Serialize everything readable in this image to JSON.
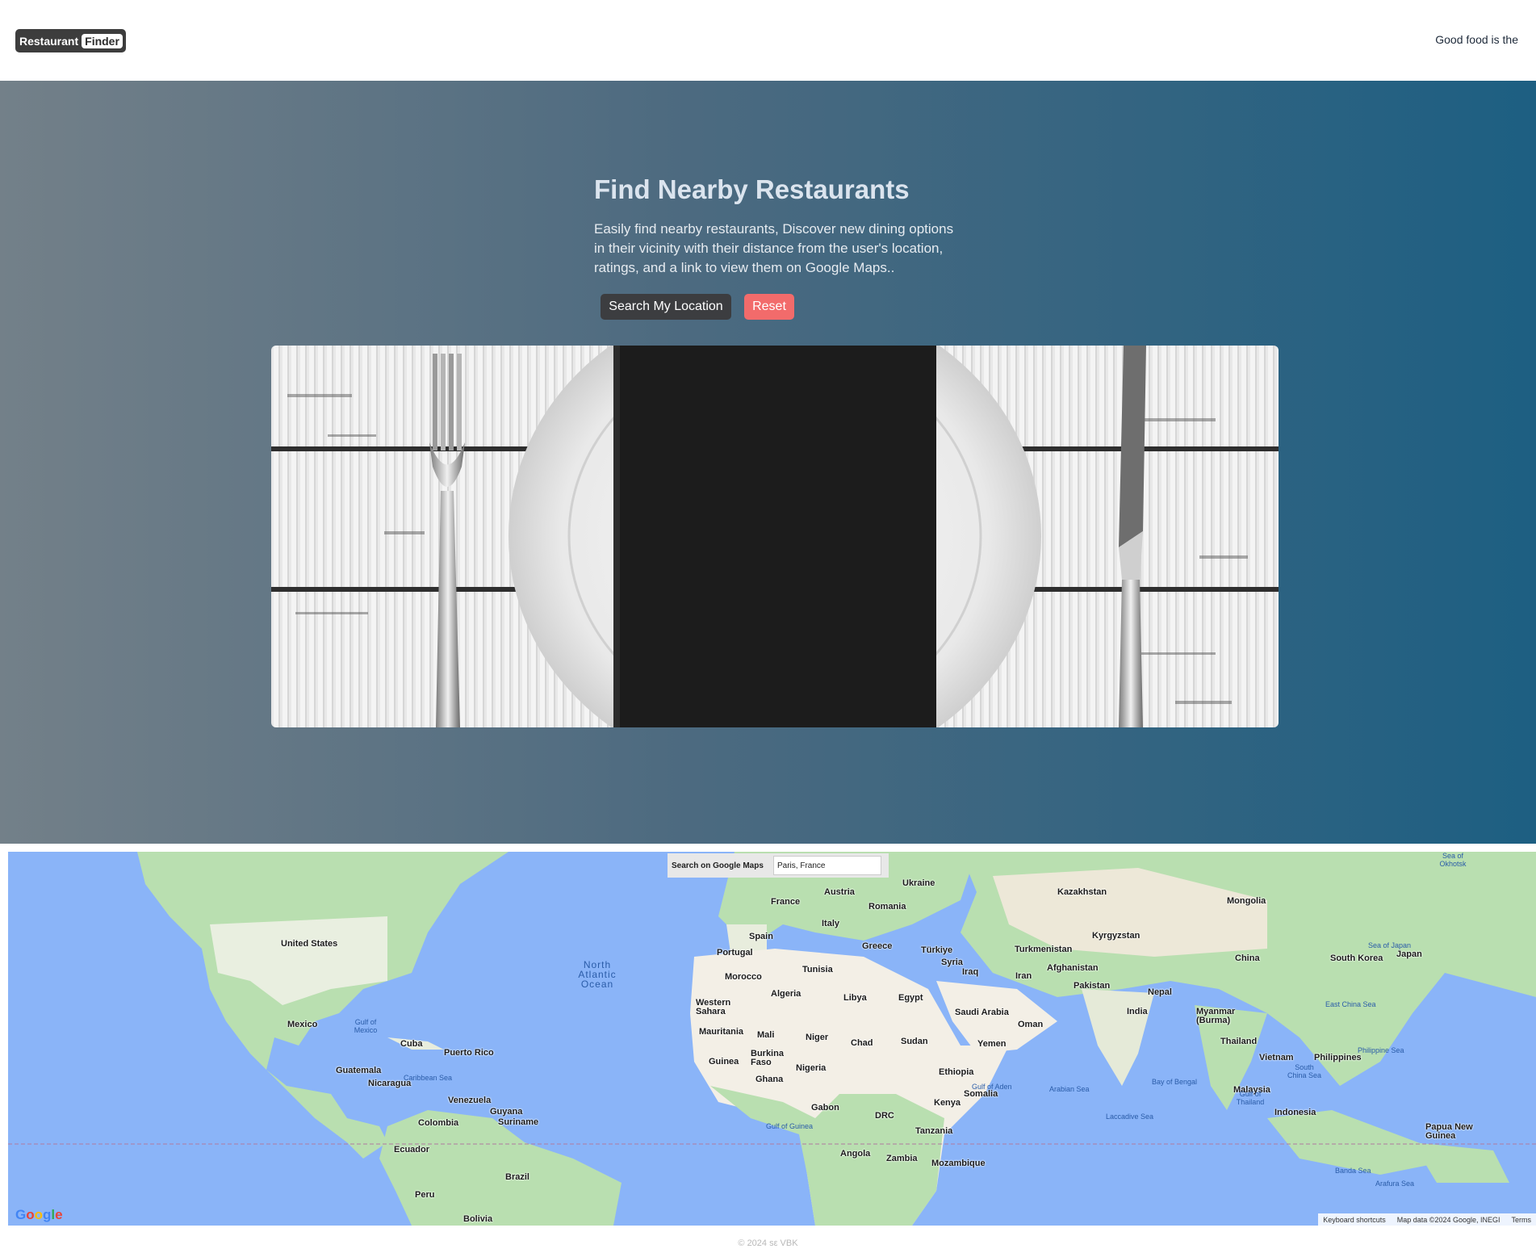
{
  "navbar": {
    "brand_part1": "Restaurant",
    "brand_part2": "Finder",
    "tagline": "Good food is the"
  },
  "hero": {
    "title": "Find Nearby Restaurants",
    "description": "Easily find nearby restaurants, Discover new dining options in their vicinity with their distance from the user's location, ratings, and a link to view them on Google Maps..",
    "search_button": "Search My Location",
    "reset_button": "Reset"
  },
  "map": {
    "search_label": "Search on Google Maps",
    "search_value": "Paris, France",
    "logo": "Google",
    "footer": [
      "Keyboard shortcuts",
      "Map data ©2024 Google, INEGI",
      "Terms"
    ],
    "countries": [
      "United States",
      "Mexico",
      "Cuba",
      "Puerto Rico",
      "Guatemala",
      "Nicaragua",
      "Venezuela",
      "Guyana",
      "Suriname",
      "Colombia",
      "Ecuador",
      "Peru",
      "Brazil",
      "Bolivia",
      "France",
      "Austria",
      "Ukraine",
      "Kazakhstan",
      "Mongolia",
      "Romania",
      "Italy",
      "Spain",
      "Portugal",
      "Greece",
      "Türkiye",
      "Turkmenistan",
      "Kyrgyzstan",
      "Tunisia",
      "Syria",
      "Iraq",
      "Iran",
      "Afghanistan",
      "Pakistan",
      "China",
      "South Korea",
      "Japan",
      "Morocco",
      "Algeria",
      "Libya",
      "Egypt",
      "Western Sahara",
      "Saudi Arabia",
      "Oman",
      "Nepal",
      "India",
      "Myanmar (Burma)",
      "Mauritania",
      "Mali",
      "Niger",
      "Chad",
      "Sudan",
      "Yemen",
      "Thailand",
      "Philippines",
      "Vietnam",
      "Guinea",
      "Burkina Faso",
      "Nigeria",
      "Ghana",
      "Ethiopia",
      "Somalia",
      "Malaysia",
      "Kenya",
      "Gabon",
      "DRC",
      "Indonesia",
      "Tanzania",
      "Papua New Guinea",
      "Angola",
      "Zambia",
      "Mozambique"
    ],
    "oceans": [
      "North Atlantic Ocean",
      "Gulf of Mexico",
      "Caribbean Sea",
      "Gulf of Guinea",
      "Arabian Sea",
      "Gulf of Aden",
      "Laccadive Sea",
      "Bay of Bengal",
      "Sea of Japan",
      "East China Sea",
      "Philippine Sea",
      "South China Sea",
      "Gulf of Thailand",
      "Banda Sea",
      "Arafura Sea",
      "Sea of Okhotsk"
    ]
  },
  "footer": {
    "copyright": "© 2024 sε VBK"
  },
  "colors": {
    "brand_bg": "#3d3d3d",
    "reset_button": "#f26b6b",
    "search_button": "#3c3d40",
    "ocean": "#8ab4f8",
    "land": "#b9dfb0",
    "desert": "#f3efe6"
  }
}
